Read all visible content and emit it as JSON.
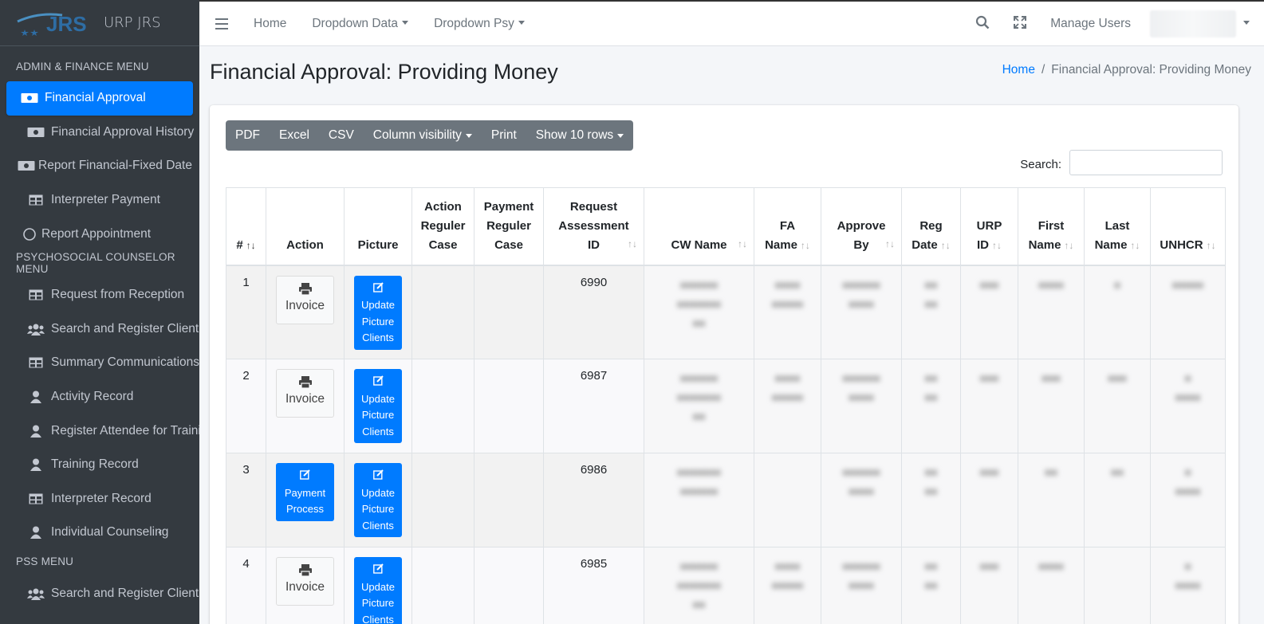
{
  "brand": {
    "logo_text": "JRS",
    "app_name": "URP JRS"
  },
  "sidebar": {
    "sections": [
      {
        "header": "ADMIN & FINANCE MENU",
        "items": [
          {
            "label": "Financial Approval",
            "icon": "money-bill-icon",
            "active": true
          },
          {
            "label": "Financial Approval History",
            "icon": "money-bill-icon"
          },
          {
            "label": "Report Financial-Fixed Date",
            "icon": "money-bill-icon"
          },
          {
            "label": "Interpreter Payment",
            "icon": "table-icon"
          },
          {
            "label": "Report Appointment",
            "icon": "circle-icon"
          }
        ]
      },
      {
        "header": "PSYCHOSOCIAL COUNSELOR MENU",
        "items": [
          {
            "label": "Request from Reception",
            "icon": "table-icon"
          },
          {
            "label": "Search and Register Client",
            "icon": "users-icon"
          },
          {
            "label": "Summary Communications",
            "icon": "table-icon"
          },
          {
            "label": "Activity Record",
            "icon": "user-icon"
          },
          {
            "label": "Register Attendee for Training",
            "icon": "user-icon"
          },
          {
            "label": "Training Record",
            "icon": "user-icon"
          },
          {
            "label": "Interpreter Record",
            "icon": "table-icon"
          },
          {
            "label": "Individual Counseling",
            "icon": "user-icon"
          }
        ]
      },
      {
        "header": "PSS MENU",
        "items": [
          {
            "label": "Search and Register Client",
            "icon": "users-icon"
          }
        ]
      }
    ]
  },
  "topnav": {
    "home": "Home",
    "dropdown_data": "Dropdown Data",
    "dropdown_psy": "Dropdown Psy",
    "manage_users": "Manage Users"
  },
  "page": {
    "title": "Financial Approval: Providing Money",
    "breadcrumb": {
      "home": "Home",
      "current": "Financial Approval: Providing Money"
    }
  },
  "toolbar": {
    "pdf": "PDF",
    "excel": "Excel",
    "csv": "CSV",
    "column_visibility": "Column visibility",
    "print": "Print",
    "show_rows": "Show 10 rows"
  },
  "search": {
    "label": "Search:",
    "value": ""
  },
  "table": {
    "headers": {
      "num": "#",
      "action": "Action",
      "picture": "Picture",
      "action_reg_1": "Action",
      "action_reg_2": "Reguler",
      "action_reg_3": "Case",
      "pay_reg_1": "Payment",
      "pay_reg_2": "Reguler",
      "pay_reg_3": "Case",
      "req_1": "Request",
      "req_2": "Assessment",
      "req_3": "ID",
      "cw": "CW Name",
      "fa_1": "FA",
      "fa_2": "Name",
      "appr_1": "Approve",
      "appr_2": "By",
      "reg_1": "Reg",
      "reg_2": "Date",
      "urp_1": "URP",
      "urp_2": "ID",
      "first_1": "First",
      "first_2": "Name",
      "last_1": "Last",
      "last_2": "Name",
      "unhcr": "UNHCR"
    },
    "buttons": {
      "invoice": "Invoice",
      "payment_1": "Payment",
      "payment_2": "Process",
      "update_1": "Update",
      "update_2": "Picture",
      "update_3": "Clients"
    },
    "rows": [
      {
        "num": "1",
        "request_id": "6990",
        "action": "invoice"
      },
      {
        "num": "2",
        "request_id": "6987",
        "action": "invoice"
      },
      {
        "num": "3",
        "request_id": "6986",
        "action": "payment"
      },
      {
        "num": "4",
        "request_id": "6985",
        "action": "invoice"
      }
    ]
  },
  "colors": {
    "primary": "#007bff",
    "sidebar_bg": "#343a40",
    "secondary": "#6c757d"
  }
}
